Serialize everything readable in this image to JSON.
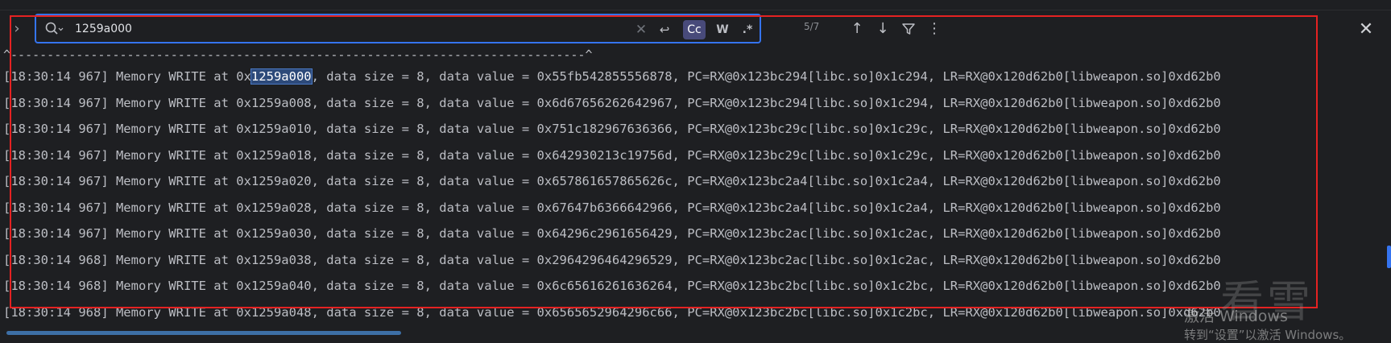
{
  "search": {
    "value": "1259a000",
    "match_count": "5/7",
    "case_label": "Cc",
    "word_label": "W",
    "regex_label": ".*"
  },
  "caret_line": "^-------------------------------------------------------------------------------^",
  "log_lines": [
    {
      "before": "[18:30:14 967] Memory WRITE at 0x",
      "match": "1259a000",
      "after": ", data size = 8, data value = 0x55fb542855556878, PC=RX@0x123bc294[libc.so]0x1c294, LR=RX@0x120d62b0[libweapon.so]0xd62b0"
    },
    {
      "before": "[18:30:14 967] Memory WRITE at 0x1259a008, data size = 8, data value = 0x6d67656262642967, PC=RX@0x123bc294[libc.so]0x1c294, LR=RX@0x120d62b0[libweapon.so]0xd62b0",
      "match": "",
      "after": ""
    },
    {
      "before": "[18:30:14 967] Memory WRITE at 0x1259a010, data size = 8, data value = 0x751c182967636366, PC=RX@0x123bc29c[libc.so]0x1c29c, LR=RX@0x120d62b0[libweapon.so]0xd62b0",
      "match": "",
      "after": ""
    },
    {
      "before": "[18:30:14 967] Memory WRITE at 0x1259a018, data size = 8, data value = 0x642930213c19756d, PC=RX@0x123bc29c[libc.so]0x1c29c, LR=RX@0x120d62b0[libweapon.so]0xd62b0",
      "match": "",
      "after": ""
    },
    {
      "before": "[18:30:14 967] Memory WRITE at 0x1259a020, data size = 8, data value = 0x657861657865626c, PC=RX@0x123bc2a4[libc.so]0x1c2a4, LR=RX@0x120d62b0[libweapon.so]0xd62b0",
      "match": "",
      "after": ""
    },
    {
      "before": "[18:30:14 967] Memory WRITE at 0x1259a028, data size = 8, data value = 0x67647b6366642966, PC=RX@0x123bc2a4[libc.so]0x1c2a4, LR=RX@0x120d62b0[libweapon.so]0xd62b0",
      "match": "",
      "after": ""
    },
    {
      "before": "[18:30:14 967] Memory WRITE at 0x1259a030, data size = 8, data value = 0x64296c2961656429, PC=RX@0x123bc2ac[libc.so]0x1c2ac, LR=RX@0x120d62b0[libweapon.so]0xd62b0",
      "match": "",
      "after": ""
    },
    {
      "before": "[18:30:14 968] Memory WRITE at 0x1259a038, data size = 8, data value = 0x2964296464296529, PC=RX@0x123bc2ac[libc.so]0x1c2ac, LR=RX@0x120d62b0[libweapon.so]0xd62b0",
      "match": "",
      "after": ""
    },
    {
      "before": "[18:30:14 968] Memory WRITE at 0x1259a040, data size = 8, data value = 0x6c65616261636264, PC=RX@0x123bc2bc[libc.so]0x1c2bc, LR=RX@0x120d62b0[libweapon.so]0xd62b0",
      "match": "",
      "after": ""
    },
    {
      "before": "[18:30:14 968] Memory WRITE at 0x1259a048, data size = 8, data value = 0x6565652964296c66, PC=RX@0x123bc2bc[libc.so]0x1c2bc, LR=RX@0x120d62b0[libweapon.so]0xd62b0",
      "match": "",
      "after": ""
    }
  ],
  "watermark": {
    "site": "看雪",
    "activate_line1": "激活 Windows",
    "activate_line2": "转到“设置”以激活 Windows。"
  },
  "icons": {
    "expand": "chevron-right-icon",
    "search": "search-icon",
    "clear": "clear-icon",
    "newline": "newline-icon",
    "prev": "arrow-up-icon",
    "next": "arrow-down-icon",
    "filter": "filter-icon",
    "more": "more-vertical-icon",
    "close": "close-icon"
  },
  "colors": {
    "background": "#1e1f22",
    "search_border": "#3574f0",
    "annotation_box": "#e52222",
    "match_highlight": "#2d4a7a"
  }
}
